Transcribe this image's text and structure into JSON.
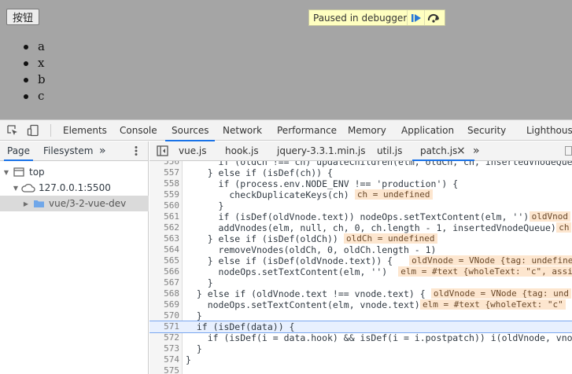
{
  "page": {
    "button_label": "按钮",
    "list_items": [
      "a",
      "x",
      "b",
      "c"
    ],
    "paused_text": "Paused in debugger"
  },
  "devtools": {
    "tabs": [
      "Elements",
      "Console",
      "Sources",
      "Network",
      "Performance",
      "Memory",
      "Application",
      "Security",
      "Lighthouse"
    ],
    "active_tab": "Sources"
  },
  "navigator": {
    "tabs": [
      "Page",
      "Filesystem"
    ],
    "more": "»",
    "tree": {
      "top": "top",
      "host": "127.0.0.1:5500",
      "folder": "vue/3-2-vue-dev"
    }
  },
  "editor": {
    "tabs": [
      "vue.js",
      "hook.js",
      "jquery-3.3.1.min.js",
      "util.js",
      "patch.js"
    ],
    "active_tab": "patch.js",
    "more": "»",
    "close": "×"
  },
  "code": {
    "exec_line": 571,
    "lines": [
      {
        "n": "556",
        "text": "      if (oldCh !== ch) updateChildren(elm, oldCh, ch, insertedVnodeQueue"
      },
      {
        "n": "557",
        "text": "    } else if (isDef(ch)) {"
      },
      {
        "n": "558",
        "text": "      if (process.env.NODE_ENV !== 'production') {"
      },
      {
        "n": "559",
        "text": "        checkDuplicateKeys(ch)"
      },
      {
        "n": "560",
        "text": "      }"
      },
      {
        "n": "561",
        "text": "      if (isDef(oldVnode.text)) nodeOps.setTextContent(elm, '')"
      },
      {
        "n": "562",
        "text": "      addVnodes(elm, null, ch, 0, ch.length - 1, insertedVnodeQueue)"
      },
      {
        "n": "563",
        "text": "    } else if (isDef(oldCh)) {"
      },
      {
        "n": "564",
        "text": "      removeVnodes(oldCh, 0, oldCh.length - 1)"
      },
      {
        "n": "565",
        "text": "    } else if (isDef(oldVnode.text)) {"
      },
      {
        "n": "566",
        "text": "      nodeOps.setTextContent(elm, '')"
      },
      {
        "n": "567",
        "text": "    }"
      },
      {
        "n": "568",
        "text": "  } else if (oldVnode.text !== vnode.text) {"
      },
      {
        "n": "569",
        "text": "    nodeOps.setTextContent(elm, vnode.text)"
      },
      {
        "n": "570",
        "text": "  }"
      },
      {
        "n": "571",
        "text": "  if (isDef(data)) {"
      },
      {
        "n": "572",
        "text": "    if (isDef(i = data.hook) && isDef(i = i.postpatch)) i(oldVnode, vnod"
      },
      {
        "n": "573",
        "text": "  }"
      },
      {
        "n": "574",
        "text": "}"
      },
      {
        "n": "575",
        "text": ""
      }
    ],
    "inline_values": [
      {
        "line": "559",
        "text": "ch = undefined"
      },
      {
        "line": "561",
        "text": "oldVnod"
      },
      {
        "line": "562",
        "text": "ch"
      },
      {
        "line": "563",
        "text": "oldCh = undefined"
      },
      {
        "line": "565",
        "text": "oldVnode = VNode {tag: undefined"
      },
      {
        "line": "566",
        "text": "elm = #text {wholeText: \"c\", assi"
      },
      {
        "line": "568",
        "text": "oldVnode = VNode {tag: und"
      },
      {
        "line": "569",
        "text": "elm = #text {wholeText: \"c\""
      }
    ]
  }
}
